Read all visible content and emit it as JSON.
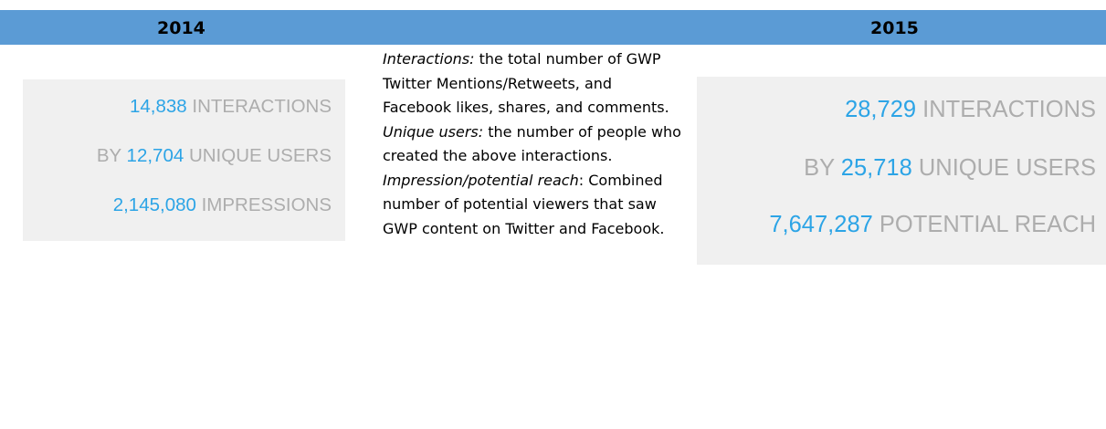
{
  "header": {
    "year_left": "2014",
    "year_right": "2015",
    "bar_color": "#5b9bd5"
  },
  "stats_2014": {
    "interactions_value": "14,838",
    "interactions_label": " INTERACTIONS",
    "users_prefix": "BY ",
    "users_value": "12,704",
    "users_label": " UNIQUE USERS",
    "impressions_value": "2,145,080",
    "impressions_label": " IMPRESSIONS"
  },
  "stats_2015": {
    "interactions_value": "28,729",
    "interactions_label": " INTERACTIONS",
    "users_prefix": "BY ",
    "users_value": "25,718",
    "users_label": " UNIQUE USERS",
    "reach_value": "7,647,287",
    "reach_label": " POTENTIAL REACH"
  },
  "definitions": {
    "interactions_term": "Interactions:",
    "interactions_text": " the total number of GWP Twitter Mentions/Retweets, and Facebook likes, shares, and comments.",
    "users_term": "Unique users:",
    "users_text": " the number of people who created the above interactions.",
    "reach_term": "Impression/potential reach",
    "reach_text": ": Combined number of potential viewers that saw GWP content on Twitter and Facebook."
  },
  "colors": {
    "number": "#2ca4e6",
    "label": "#adadad",
    "box_bg": "#f0f0f0"
  }
}
